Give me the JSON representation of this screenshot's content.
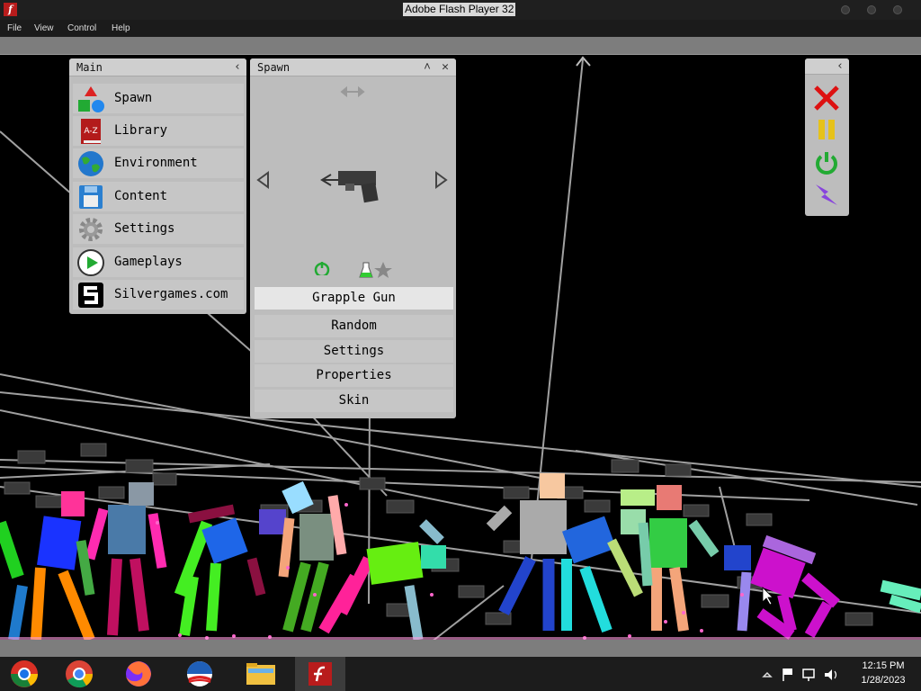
{
  "window": {
    "title": "Adobe Flash Player 32"
  },
  "menu": [
    "File",
    "View",
    "Control",
    "Help"
  ],
  "main_panel": {
    "title": "Main",
    "items": [
      {
        "label": "Spawn",
        "icon": "shapes-icon"
      },
      {
        "label": "Library",
        "icon": "book-icon"
      },
      {
        "label": "Environment",
        "icon": "globe-icon"
      },
      {
        "label": "Content",
        "icon": "floppy-disk-icon"
      },
      {
        "label": "Settings",
        "icon": "gear-icon"
      },
      {
        "label": "Gameplays",
        "icon": "play-icon"
      },
      {
        "label": "Silvergames.com",
        "icon": "silvergames-logo-icon"
      }
    ]
  },
  "spawn_panel": {
    "title": "Spawn",
    "selected_item": "Grapple Gun",
    "options": [
      "Random",
      "Settings",
      "Properties",
      "Skin"
    ]
  },
  "controls_panel": {
    "buttons": [
      "close-icon",
      "pause-icon",
      "power-icon",
      "lightning-icon"
    ]
  },
  "taskbar": {
    "apps": [
      "Chrome OS",
      "Google Chrome",
      "Firefox",
      "Obama icon",
      "File Explorer",
      "Adobe Flash Player"
    ],
    "time": "12:15 PM",
    "date": "1/28/2023"
  },
  "colors": {
    "panel": "#bdbdbd",
    "panel_header": "#cfcfcf",
    "taskbar": "#1c1c1c"
  }
}
